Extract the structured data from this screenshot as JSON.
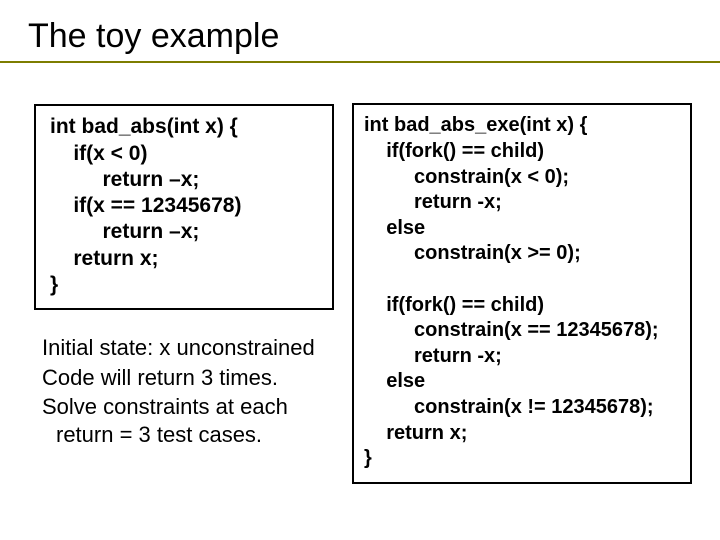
{
  "title": "The toy example",
  "left_code": "int bad_abs(int x) {\n    if(x < 0)\n         return –x;\n    if(x == 12345678)\n         return –x;\n    return x;\n}",
  "right_code": "int bad_abs_exe(int x) {\n    if(fork() == child)\n         constrain(x < 0);\n         return -x;\n    else\n         constrain(x >= 0);\n\n    if(fork() == child)\n         constrain(x == 12345678);\n         return -x;\n    else\n         constrain(x != 12345678);\n    return x;\n}",
  "caption_lines": [
    "Initial state: x unconstrained",
    "Code will return 3 times.",
    "Solve constraints at each return = 3 test cases."
  ]
}
